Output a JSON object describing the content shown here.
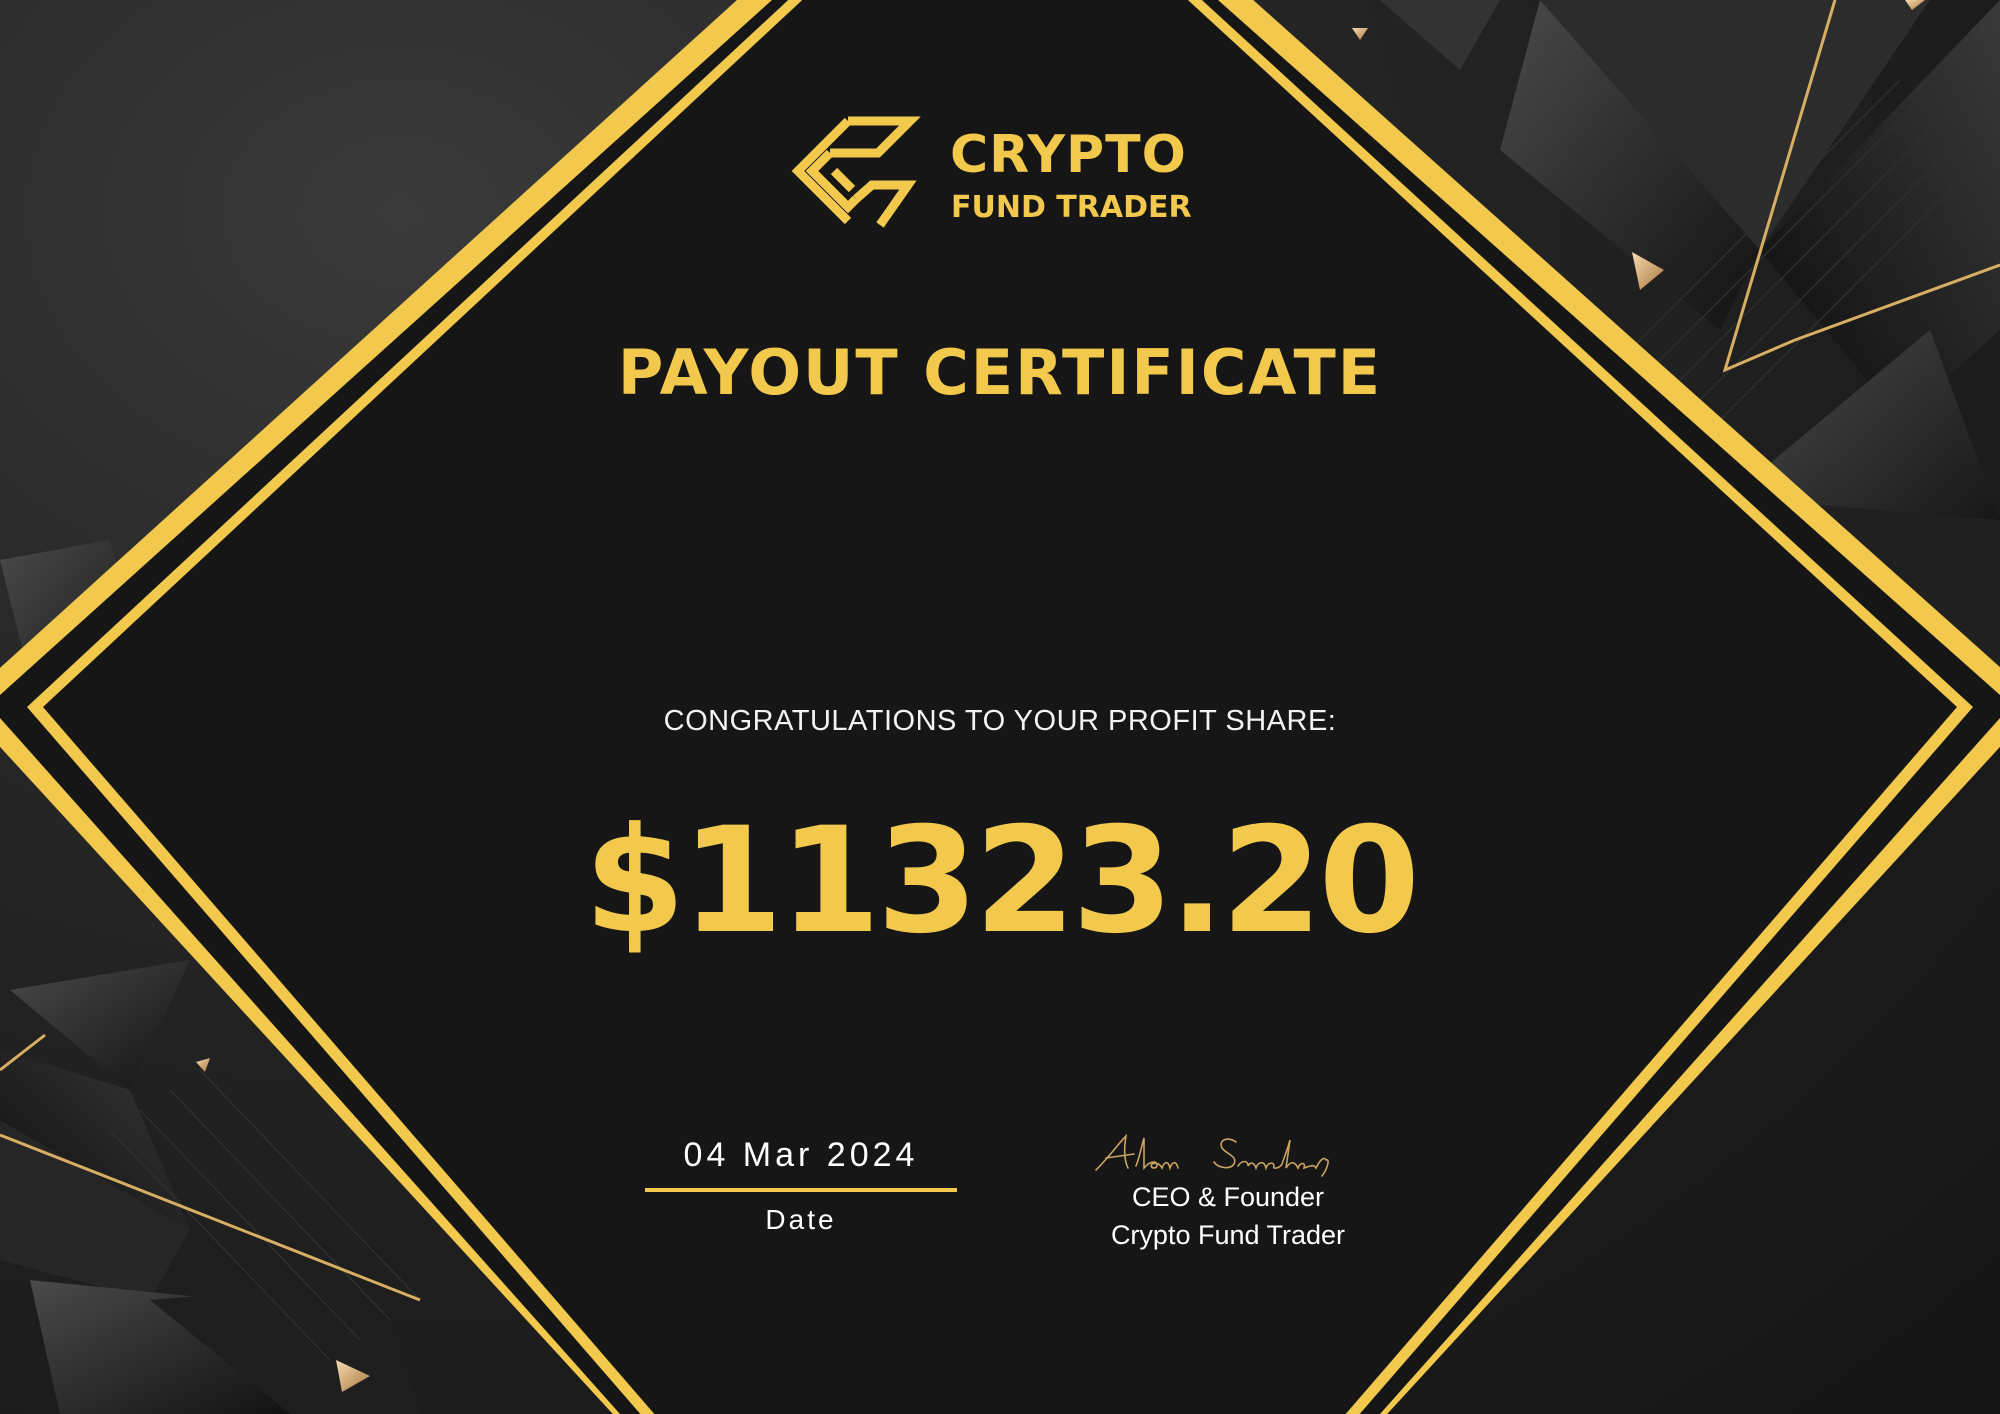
{
  "brand": {
    "name_line1": "CRYPTO",
    "name_line2": "FUND TRADER",
    "logo_icon": "stacked-diamond-chevron-logo"
  },
  "certificate": {
    "title": "PAYOUT CERTIFICATE",
    "subtitle": "CONGRATULATIONS TO YOUR PROFIT SHARE:",
    "amount": "$11323.20",
    "date": "04 Mar 2024",
    "date_label": "Date",
    "signature_name": "Alan Sanchez",
    "signer_title": "CEO & Founder",
    "signer_company": "Crypto Fund Trader"
  },
  "colors": {
    "accent": "#f2c94c",
    "panel": "#161616",
    "background": "#222222",
    "text": "#ffffff",
    "decor_gold": "#d8ae63"
  }
}
